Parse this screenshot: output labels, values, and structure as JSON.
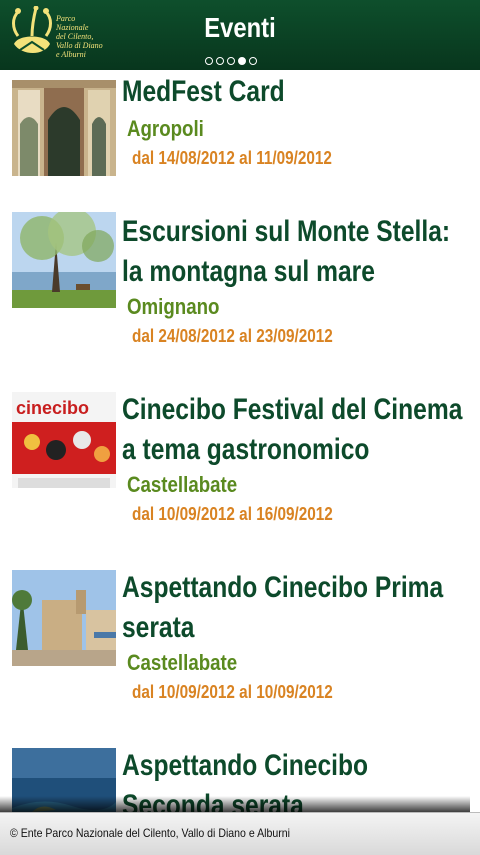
{
  "header": {
    "title": "Eventi",
    "logo_lines": [
      "Parco Nazionale",
      "del Cilento,",
      "Vallo di Diano",
      "e Alburni"
    ],
    "pager": {
      "count": 5,
      "active_index": 3
    }
  },
  "events": [
    {
      "title": "MedFest Card",
      "place": "Agropoli",
      "dates": "dal 14/08/2012 al 11/09/2012",
      "thumb_icon": "arcade-photo"
    },
    {
      "title": "Escursioni sul Monte Stella: la montagna sul mare",
      "place": "Omignano",
      "dates": "dal 24/08/2012 al 23/09/2012",
      "thumb_icon": "tree-sea-photo"
    },
    {
      "title": "Cinecibo Festival del Cinema a tema gastronomico",
      "place": "Castellabate",
      "dates": "dal 10/09/2012 al 16/09/2012",
      "thumb_icon": "cinecibo-poster"
    },
    {
      "title": "Aspettando Cinecibo Prima serata",
      "place": "Castellabate",
      "dates": "dal 10/09/2012 al 10/09/2012",
      "thumb_icon": "seaside-town-photo"
    },
    {
      "title": "Aspettando Cinecibo Seconda serata",
      "place": "",
      "dates": "",
      "thumb_icon": "coast-photo"
    }
  ],
  "poster_text": "cinecibo",
  "footer": {
    "text": "© Ente Parco Nazionale del Cilento, Vallo di Diano e Alburni"
  }
}
